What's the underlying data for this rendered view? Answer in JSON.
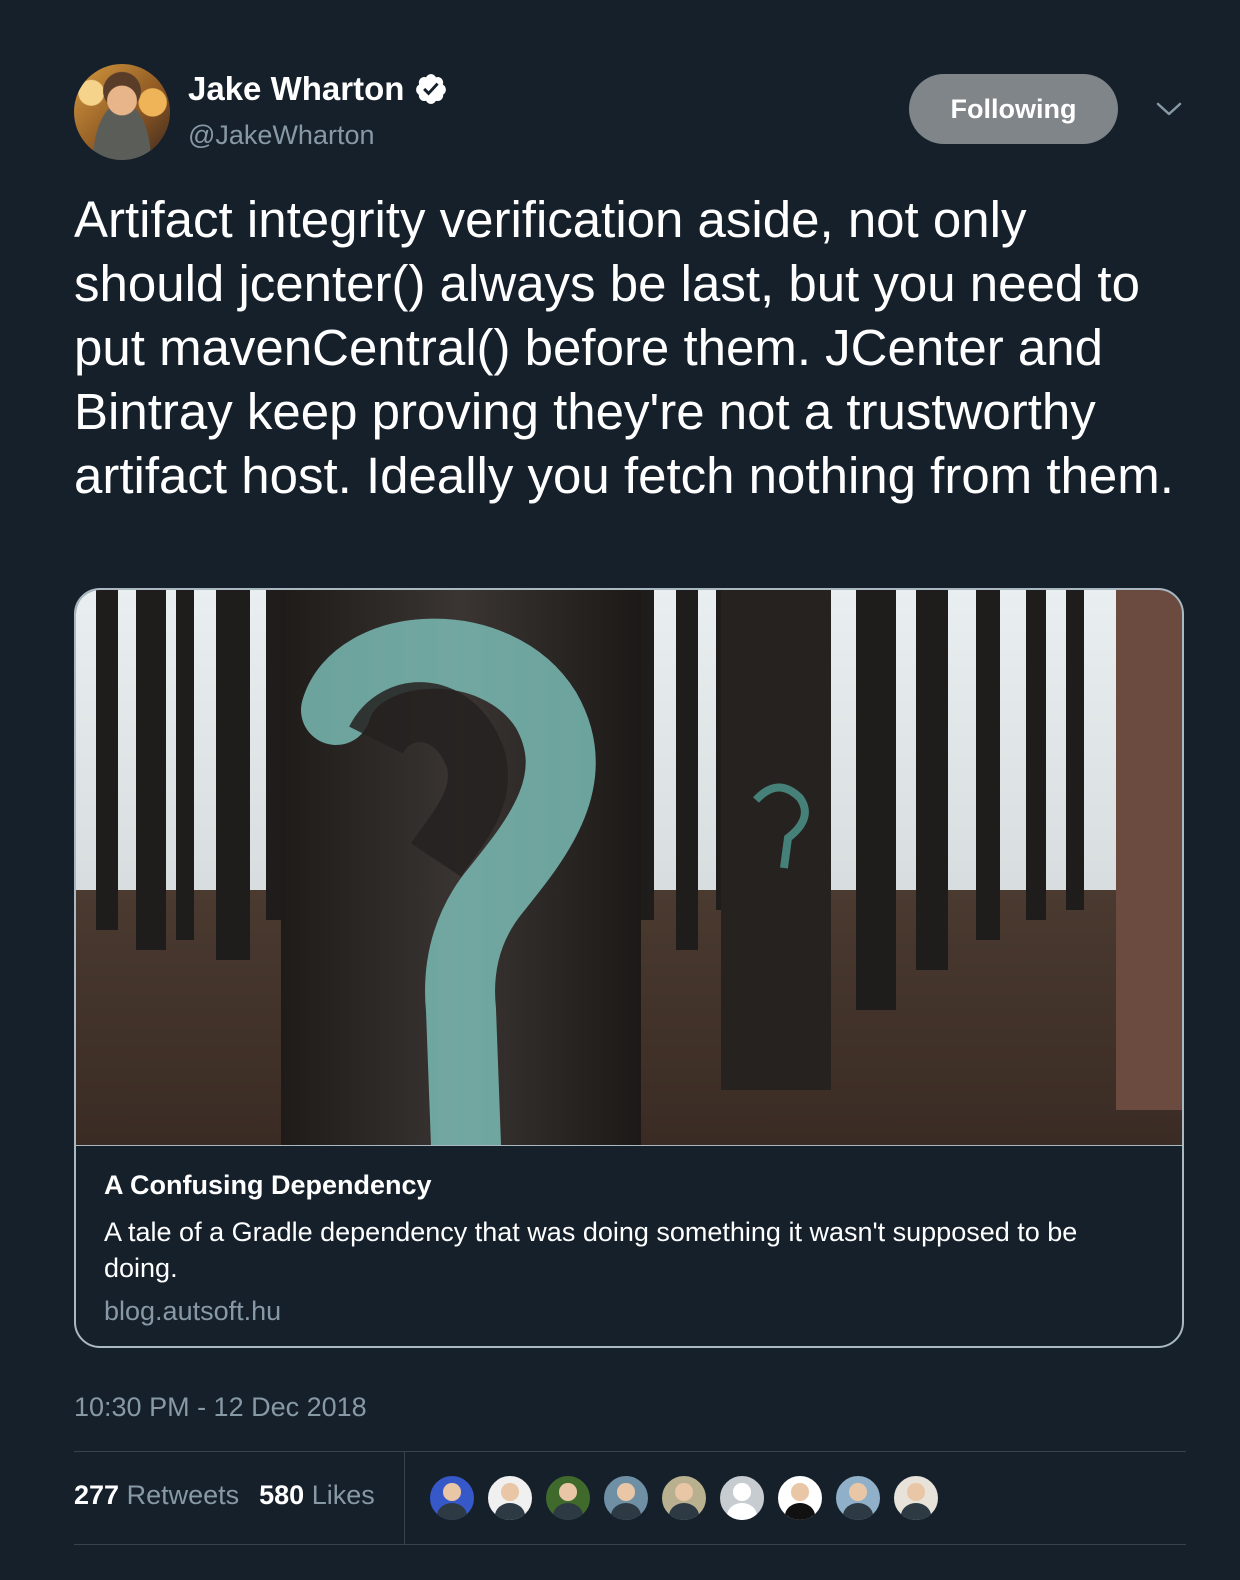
{
  "author": {
    "name": "Jake Wharton",
    "handle": "@JakeWharton",
    "verified": true
  },
  "follow_button": {
    "label": "Following"
  },
  "tweet": {
    "text": "Artifact integrity verification aside, not only should jcenter() always be last, but you need to put mavenCentral() before them. JCenter and Bintray keep proving they're not a trustworthy artifact host. Ideally you fetch nothing from them."
  },
  "card": {
    "title": "A Confusing Dependency",
    "description": "A tale of a Gradle dependency that was doing something it wasn't supposed to be doing.",
    "domain": "blog.autsoft.hu"
  },
  "timestamp": "10:30 PM - 12 Dec 2018",
  "stats": {
    "retweets_count": "277",
    "retweets_label": "Retweets",
    "likes_count": "580",
    "likes_label": "Likes"
  },
  "colors": {
    "background": "#15202b",
    "secondary_text": "#8899a6",
    "following_button": "#7f8589",
    "divider": "#38444d"
  },
  "icons": [
    "verified-badge-icon",
    "chevron-down-icon"
  ]
}
